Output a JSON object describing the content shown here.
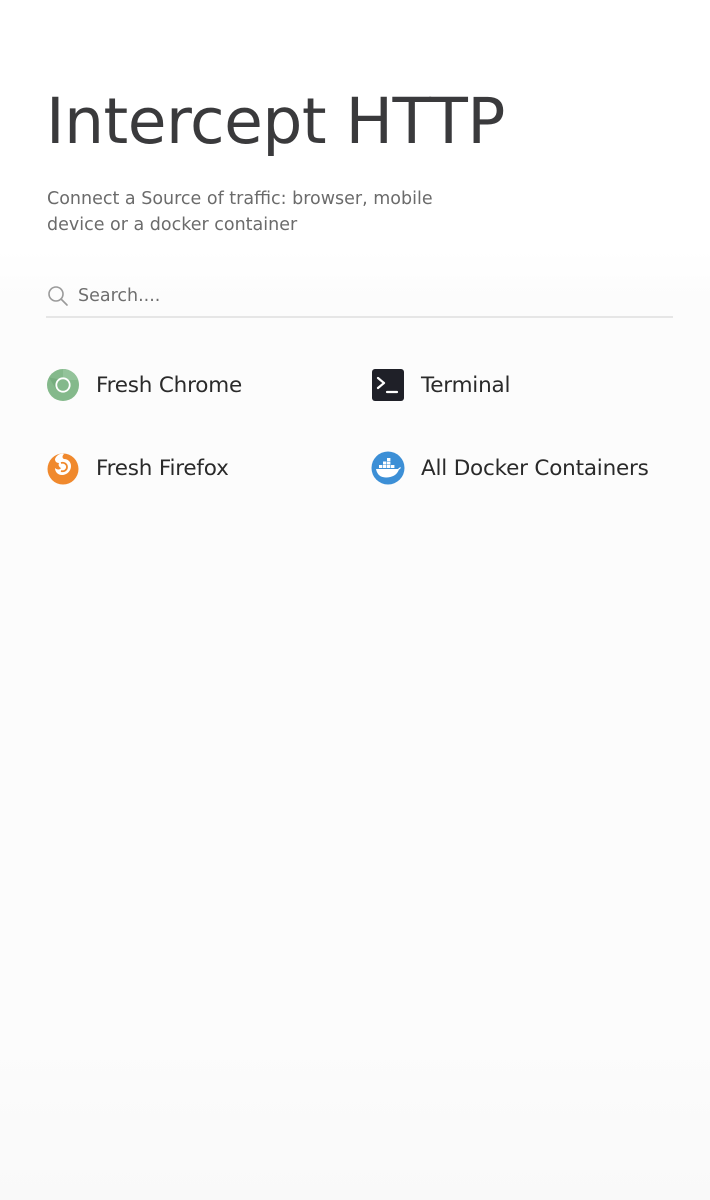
{
  "header": {
    "title": "Intercept HTTP",
    "subtitle": "Connect a Source of traffic: browser, mobile device or a docker container"
  },
  "search": {
    "placeholder": "Search...."
  },
  "sources": {
    "chrome": {
      "label": "Fresh Chrome",
      "icon": "chrome-icon",
      "color": "#7fb686"
    },
    "terminal": {
      "label": "Terminal",
      "icon": "terminal-icon",
      "color": "#1f2028"
    },
    "firefox": {
      "label": "Fresh Firefox",
      "icon": "firefox-icon",
      "color": "#f0892d"
    },
    "docker": {
      "label": "All Docker Containers",
      "icon": "docker-icon",
      "color": "#3c8fd6"
    }
  }
}
